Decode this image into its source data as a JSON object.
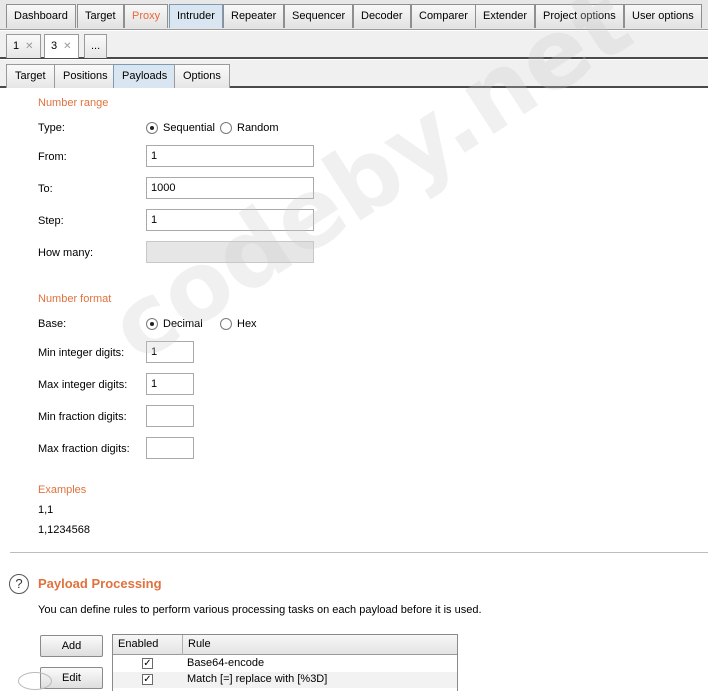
{
  "tool_tabs": [
    {
      "label": "Dashboard"
    },
    {
      "label": "Target"
    },
    {
      "label": "Proxy"
    },
    {
      "label": "Intruder"
    },
    {
      "label": "Repeater"
    },
    {
      "label": "Sequencer"
    },
    {
      "label": "Decoder"
    },
    {
      "label": "Comparer"
    },
    {
      "label": "Extender"
    },
    {
      "label": "Project options"
    },
    {
      "label": "User options"
    }
  ],
  "attack_tabs": [
    {
      "label": "1"
    },
    {
      "label": "3"
    },
    {
      "label": "..."
    }
  ],
  "sub_tabs": [
    {
      "label": "Target"
    },
    {
      "label": "Positions"
    },
    {
      "label": "Payloads"
    },
    {
      "label": "Options"
    }
  ],
  "number_range": {
    "title": "Number range",
    "type_label": "Type:",
    "type_options": [
      "Sequential",
      "Random"
    ],
    "type_selected": "Sequential",
    "from_label": "From:",
    "from_value": "1",
    "to_label": "To:",
    "to_value": "1000",
    "step_label": "Step:",
    "step_value": "1",
    "how_many_label": "How many:",
    "how_many_value": ""
  },
  "number_format": {
    "title": "Number format",
    "base_label": "Base:",
    "base_options": [
      "Decimal",
      "Hex"
    ],
    "base_selected": "Decimal",
    "min_int_label": "Min integer digits:",
    "min_int_value": "1",
    "max_int_label": "Max integer digits:",
    "max_int_value": "1",
    "min_frac_label": "Min fraction digits:",
    "min_frac_value": "",
    "max_frac_label": "Max fraction digits:",
    "max_frac_value": ""
  },
  "examples": {
    "title": "Examples",
    "values": [
      "1,1",
      "1,1234568"
    ]
  },
  "payload_processing": {
    "help_glyph": "?",
    "title": "Payload Processing",
    "description": "You can define rules to perform various processing tasks on each payload before it is used.",
    "add_label": "Add",
    "edit_label": "Edit",
    "columns": [
      "Enabled",
      "Rule"
    ],
    "rows": [
      {
        "enabled": true,
        "rule": "Base64-encode"
      },
      {
        "enabled": true,
        "rule": "Match [=] replace with [%3D]"
      }
    ]
  },
  "watermark": "codeby.net",
  "colors": {
    "accent": "#e0723e",
    "active_tab": "#d9e6f1"
  }
}
